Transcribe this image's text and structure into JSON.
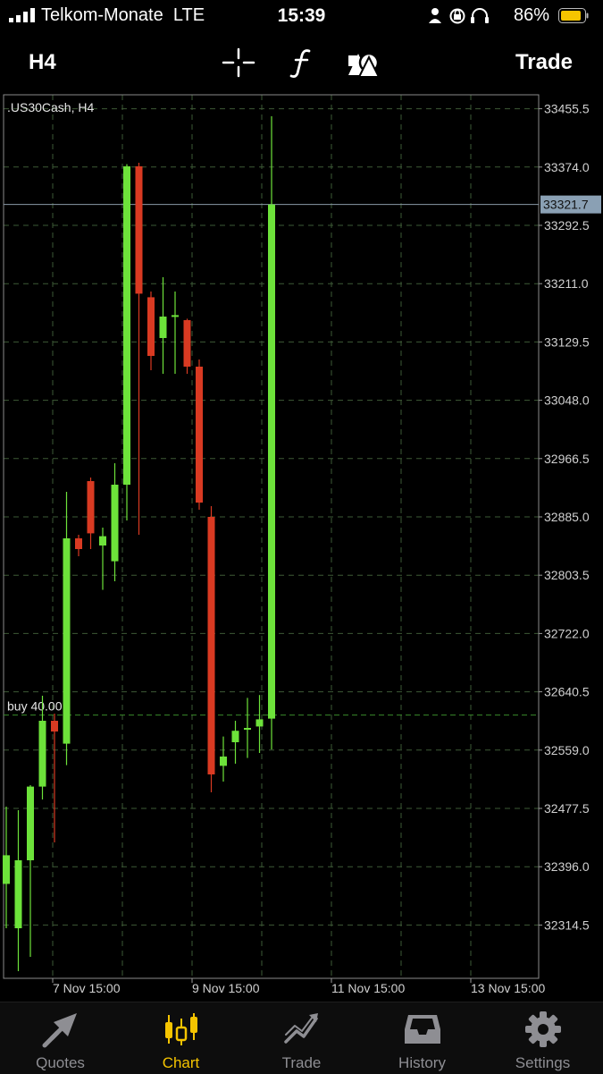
{
  "status_bar": {
    "carrier": "Telkom-Monate",
    "network": "LTE",
    "time": "15:39",
    "battery": "86%"
  },
  "toolbar": {
    "timeframe": "H4",
    "trade_label": "Trade",
    "tools": [
      "crosshair-icon",
      "function-icon",
      "shapes-icon"
    ]
  },
  "chart_data": {
    "type": "candlestick",
    "title": ".US30Cash, H4",
    "current_price": "33321.7",
    "order_line": {
      "label": "buy 40.00",
      "price": 32608
    },
    "y_ticks": [
      "33455.5",
      "33374.0",
      "33292.5",
      "33211.0",
      "33129.5",
      "33048.0",
      "32966.5",
      "32885.0",
      "32803.5",
      "32722.0",
      "32640.5",
      "32559.0",
      "32477.5",
      "32396.0",
      "32314.5"
    ],
    "x_ticks": [
      "7 Nov 15:00",
      "9 Nov 15:00",
      "11 Nov 15:00",
      "13 Nov 15:00"
    ],
    "ylim": [
      32240,
      33475
    ],
    "candles": [
      {
        "o": 32372,
        "h": 32480,
        "l": 32310,
        "c": 32412
      },
      {
        "o": 32310,
        "h": 32475,
        "l": 32250,
        "c": 32405
      },
      {
        "o": 32405,
        "h": 32510,
        "l": 32270,
        "c": 32508
      },
      {
        "o": 32508,
        "h": 32635,
        "l": 32490,
        "c": 32600
      },
      {
        "o": 32600,
        "h": 32610,
        "l": 32430,
        "c": 32585
      },
      {
        "o": 32568,
        "h": 32920,
        "l": 32538,
        "c": 32855
      },
      {
        "o": 32855,
        "h": 32860,
        "l": 32830,
        "c": 32840
      },
      {
        "o": 32935,
        "h": 32940,
        "l": 32840,
        "c": 32862
      },
      {
        "o": 32845,
        "h": 32870,
        "l": 32783,
        "c": 32858
      },
      {
        "o": 32823,
        "h": 32960,
        "l": 32795,
        "c": 32930
      },
      {
        "o": 32930,
        "h": 33378,
        "l": 32880,
        "c": 33375
      },
      {
        "o": 33375,
        "h": 33380,
        "l": 32860,
        "c": 33197
      },
      {
        "o": 33192,
        "h": 33200,
        "l": 33090,
        "c": 33110
      },
      {
        "o": 33135,
        "h": 33220,
        "l": 33085,
        "c": 33165
      },
      {
        "o": 33165,
        "h": 33200,
        "l": 33085,
        "c": 33167
      },
      {
        "o": 33160,
        "h": 33162,
        "l": 33085,
        "c": 33095
      },
      {
        "o": 33095,
        "h": 33105,
        "l": 32895,
        "c": 32905
      },
      {
        "o": 32885,
        "h": 32900,
        "l": 32500,
        "c": 32525
      },
      {
        "o": 32537,
        "h": 32578,
        "l": 32515,
        "c": 32550
      },
      {
        "o": 32570,
        "h": 32600,
        "l": 32540,
        "c": 32586
      },
      {
        "o": 32588,
        "h": 32632,
        "l": 32548,
        "c": 32590
      },
      {
        "o": 32592,
        "h": 32636,
        "l": 32555,
        "c": 32602
      },
      {
        "o": 32603,
        "h": 33445,
        "l": 32560,
        "c": 33321.7
      }
    ],
    "colors": {
      "bull": "#6de23a",
      "bear": "#d93a22",
      "grid": "#3d5a36",
      "axis": "#9a9a9a"
    }
  },
  "tabbar": {
    "tabs": [
      {
        "label": "Quotes",
        "icon": "quotes-icon",
        "active": false
      },
      {
        "label": "Chart",
        "icon": "chart-candles-icon",
        "active": true
      },
      {
        "label": "Trade",
        "icon": "trade-icon",
        "active": false
      },
      {
        "label": "History",
        "icon": "history-icon",
        "active": false
      },
      {
        "label": "Settings",
        "icon": "settings-gear-icon",
        "active": false
      }
    ]
  }
}
